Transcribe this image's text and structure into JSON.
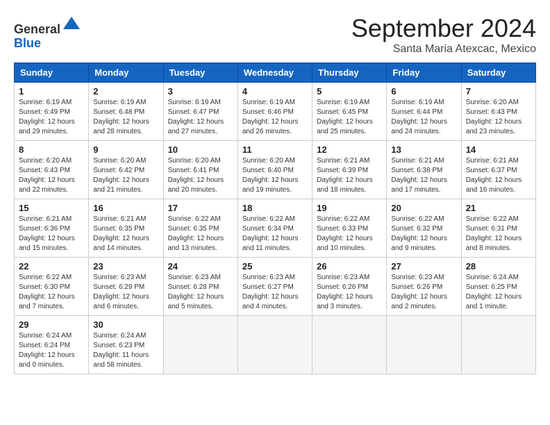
{
  "logo": {
    "line1": "General",
    "line2": "Blue"
  },
  "title": "September 2024",
  "location": "Santa Maria Atexcac, Mexico",
  "weekdays": [
    "Sunday",
    "Monday",
    "Tuesday",
    "Wednesday",
    "Thursday",
    "Friday",
    "Saturday"
  ],
  "days": [
    {
      "num": "1",
      "info": "Sunrise: 6:19 AM\nSunset: 6:49 PM\nDaylight: 12 hours\nand 29 minutes."
    },
    {
      "num": "2",
      "info": "Sunrise: 6:19 AM\nSunset: 6:48 PM\nDaylight: 12 hours\nand 28 minutes."
    },
    {
      "num": "3",
      "info": "Sunrise: 6:19 AM\nSunset: 6:47 PM\nDaylight: 12 hours\nand 27 minutes."
    },
    {
      "num": "4",
      "info": "Sunrise: 6:19 AM\nSunset: 6:46 PM\nDaylight: 12 hours\nand 26 minutes."
    },
    {
      "num": "5",
      "info": "Sunrise: 6:19 AM\nSunset: 6:45 PM\nDaylight: 12 hours\nand 25 minutes."
    },
    {
      "num": "6",
      "info": "Sunrise: 6:19 AM\nSunset: 6:44 PM\nDaylight: 12 hours\nand 24 minutes."
    },
    {
      "num": "7",
      "info": "Sunrise: 6:20 AM\nSunset: 6:43 PM\nDaylight: 12 hours\nand 23 minutes."
    },
    {
      "num": "8",
      "info": "Sunrise: 6:20 AM\nSunset: 6:43 PM\nDaylight: 12 hours\nand 22 minutes."
    },
    {
      "num": "9",
      "info": "Sunrise: 6:20 AM\nSunset: 6:42 PM\nDaylight: 12 hours\nand 21 minutes."
    },
    {
      "num": "10",
      "info": "Sunrise: 6:20 AM\nSunset: 6:41 PM\nDaylight: 12 hours\nand 20 minutes."
    },
    {
      "num": "11",
      "info": "Sunrise: 6:20 AM\nSunset: 6:40 PM\nDaylight: 12 hours\nand 19 minutes."
    },
    {
      "num": "12",
      "info": "Sunrise: 6:21 AM\nSunset: 6:39 PM\nDaylight: 12 hours\nand 18 minutes."
    },
    {
      "num": "13",
      "info": "Sunrise: 6:21 AM\nSunset: 6:38 PM\nDaylight: 12 hours\nand 17 minutes."
    },
    {
      "num": "14",
      "info": "Sunrise: 6:21 AM\nSunset: 6:37 PM\nDaylight: 12 hours\nand 16 minutes."
    },
    {
      "num": "15",
      "info": "Sunrise: 6:21 AM\nSunset: 6:36 PM\nDaylight: 12 hours\nand 15 minutes."
    },
    {
      "num": "16",
      "info": "Sunrise: 6:21 AM\nSunset: 6:35 PM\nDaylight: 12 hours\nand 14 minutes."
    },
    {
      "num": "17",
      "info": "Sunrise: 6:22 AM\nSunset: 6:35 PM\nDaylight: 12 hours\nand 13 minutes."
    },
    {
      "num": "18",
      "info": "Sunrise: 6:22 AM\nSunset: 6:34 PM\nDaylight: 12 hours\nand 11 minutes."
    },
    {
      "num": "19",
      "info": "Sunrise: 6:22 AM\nSunset: 6:33 PM\nDaylight: 12 hours\nand 10 minutes."
    },
    {
      "num": "20",
      "info": "Sunrise: 6:22 AM\nSunset: 6:32 PM\nDaylight: 12 hours\nand 9 minutes."
    },
    {
      "num": "21",
      "info": "Sunrise: 6:22 AM\nSunset: 6:31 PM\nDaylight: 12 hours\nand 8 minutes."
    },
    {
      "num": "22",
      "info": "Sunrise: 6:22 AM\nSunset: 6:30 PM\nDaylight: 12 hours\nand 7 minutes."
    },
    {
      "num": "23",
      "info": "Sunrise: 6:23 AM\nSunset: 6:29 PM\nDaylight: 12 hours\nand 6 minutes."
    },
    {
      "num": "24",
      "info": "Sunrise: 6:23 AM\nSunset: 6:28 PM\nDaylight: 12 hours\nand 5 minutes."
    },
    {
      "num": "25",
      "info": "Sunrise: 6:23 AM\nSunset: 6:27 PM\nDaylight: 12 hours\nand 4 minutes."
    },
    {
      "num": "26",
      "info": "Sunrise: 6:23 AM\nSunset: 6:26 PM\nDaylight: 12 hours\nand 3 minutes."
    },
    {
      "num": "27",
      "info": "Sunrise: 6:23 AM\nSunset: 6:26 PM\nDaylight: 12 hours\nand 2 minutes."
    },
    {
      "num": "28",
      "info": "Sunrise: 6:24 AM\nSunset: 6:25 PM\nDaylight: 12 hours\nand 1 minute."
    },
    {
      "num": "29",
      "info": "Sunrise: 6:24 AM\nSunset: 6:24 PM\nDaylight: 12 hours\nand 0 minutes."
    },
    {
      "num": "30",
      "info": "Sunrise: 6:24 AM\nSunset: 6:23 PM\nDaylight: 11 hours\nand 58 minutes."
    }
  ]
}
